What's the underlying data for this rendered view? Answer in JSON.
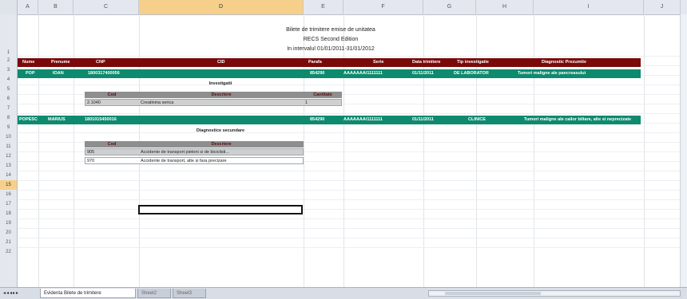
{
  "column_headers": [
    "A",
    "B",
    "C",
    "D",
    "E",
    "F",
    "G",
    "H",
    "I",
    "J"
  ],
  "selected_column": "D",
  "row_numbers": [
    "1",
    "2",
    "3",
    "4",
    "5",
    "6",
    "7",
    "8",
    "9",
    "10",
    "11",
    "12",
    "13",
    "14",
    "15",
    "16",
    "17",
    "18",
    "19",
    "20",
    "21",
    "22"
  ],
  "selected_row": "15",
  "report": {
    "title_line1": "Bilete de trimitere emise de unitatea",
    "title_line2": "RECS Second Edition",
    "title_line3": "In intervalul 01/01/2011-31/01/2012"
  },
  "main_headers": [
    "Nume",
    "Prenume",
    "CNP",
    "CID",
    "Parafa",
    "Serie",
    "Data trimitere",
    "Tip investigatie",
    "Diagnostic Prezumtiv"
  ],
  "patient1": [
    "POP",
    "IOAN",
    "1800317400056",
    "",
    "854290",
    "AAAAAAA/1111111",
    "01/11/2011",
    "DE LABORATOR",
    "Tumori maligne ale pancreasului"
  ],
  "investigatii": {
    "section_title": "Investigatii",
    "headers": [
      "Cod",
      "Descriere",
      "Cantitate"
    ],
    "row": [
      "2.1040",
      "Creatinina serica",
      "1"
    ]
  },
  "patient2": [
    "POPESC",
    "MARIUS",
    "1801015450016",
    "",
    "854290",
    "AAAAAAA/1111111",
    "01/11/2011",
    "CLINICE",
    "Tumori maligne ale cailor biliare, alte si neprecizate"
  ],
  "diagnostice": {
    "section_title": "Diagnostice secundare",
    "headers": [
      "Cod",
      "Descriere"
    ],
    "rows": [
      [
        "905",
        "Accidente de transport pietoni si de biciclisti..."
      ],
      [
        "970",
        "Accidente de transport, alte si fara precizare"
      ]
    ]
  },
  "sheet_tabs": {
    "active": "Evidenta Bilete de trimitere",
    "others": [
      "Sheet2",
      "Sheet3"
    ]
  },
  "colors": {
    "header_band": "#7a0a0a",
    "patient_band": "#0e8a6e",
    "subtable_header": "#8e8e8e",
    "selected_header": "#f6d08a"
  }
}
